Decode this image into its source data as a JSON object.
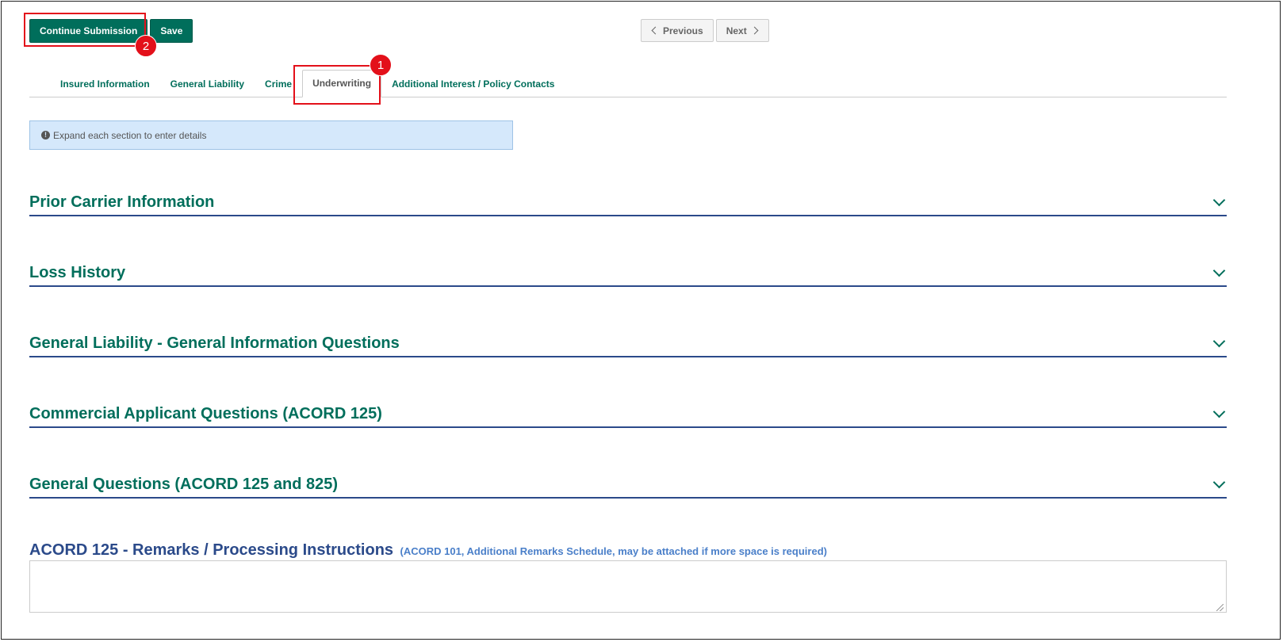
{
  "toolbar": {
    "continue_label": "Continue Submission",
    "save_label": "Save"
  },
  "pager": {
    "previous_label": "Previous",
    "next_label": "Next"
  },
  "tabs": [
    {
      "label": "Insured Information",
      "active": false
    },
    {
      "label": "General Liability",
      "active": false
    },
    {
      "label": "Crime",
      "active": false
    },
    {
      "label": "Underwriting",
      "active": true
    },
    {
      "label": "Additional Interest / Policy Contacts",
      "active": false
    }
  ],
  "info": {
    "icon": "info-circle-icon",
    "message": "Expand each section to enter details"
  },
  "sections": [
    {
      "title": "Prior Carrier Information"
    },
    {
      "title": "Loss History"
    },
    {
      "title": "General Liability - General Information Questions"
    },
    {
      "title": "Commercial Applicant Questions (ACORD 125)"
    },
    {
      "title": "General Questions (ACORD 125 and 825)"
    }
  ],
  "remarks": {
    "title": "ACORD 125 - Remarks / Processing Instructions",
    "note": "(ACORD 101, Additional Remarks Schedule, may be attached if more space is required)",
    "value": ""
  },
  "annotations": [
    {
      "number": "1",
      "target": "tab-underwriting"
    },
    {
      "number": "2",
      "target": "continue-submission-button"
    }
  ],
  "colors": {
    "primary": "#006e5b",
    "section_rule": "#2b4a8a",
    "highlight": "#e3101a",
    "info_bg": "#d5e8fb"
  }
}
